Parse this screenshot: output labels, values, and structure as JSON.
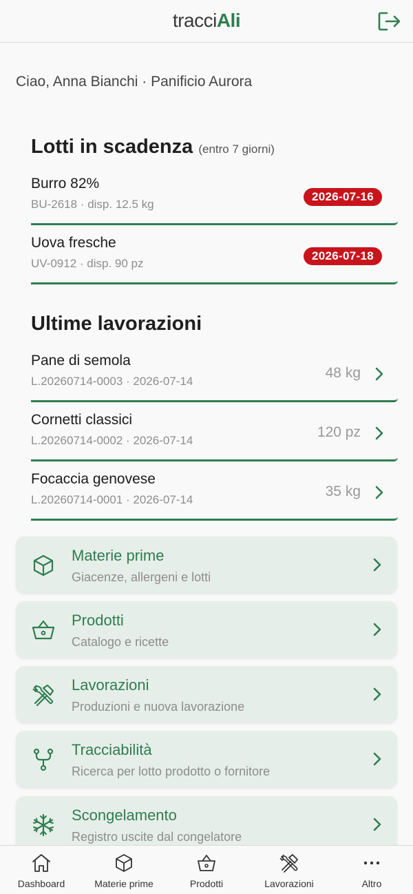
{
  "header": {
    "brand_part1": "tracci",
    "brand_part2": "Ali"
  },
  "greeting": "Ciao, Anna Bianchi · Panificio Aurora",
  "expiring": {
    "title": "Lotti in scadenza",
    "subtitle": "(entro 7 giorni)",
    "items": [
      {
        "name": "Burro 82%",
        "sub": "BU-2618 · disp. 12.5 kg",
        "date": "2026-07-16"
      },
      {
        "name": "Uova fresche",
        "sub": "UV-0912 · disp. 90 pz",
        "date": "2026-07-18"
      }
    ]
  },
  "recent": {
    "title": "Ultime lavorazioni",
    "items": [
      {
        "name": "Pane di semola",
        "sub": "L.20260714-0003 · 2026-07-14",
        "qty": "48 kg"
      },
      {
        "name": "Cornetti classici",
        "sub": "L.20260714-0002 · 2026-07-14",
        "qty": "120 pz"
      },
      {
        "name": "Focaccia genovese",
        "sub": "L.20260714-0001 · 2026-07-14",
        "qty": "35 kg"
      }
    ]
  },
  "menu": [
    {
      "title": "Materie prime",
      "desc": "Giacenze, allergeni e lotti",
      "icon": "box-icon"
    },
    {
      "title": "Prodotti",
      "desc": "Catalogo e ricette",
      "icon": "basket-icon"
    },
    {
      "title": "Lavorazioni",
      "desc": "Produzioni e nuova lavorazione",
      "icon": "tools-icon"
    },
    {
      "title": "Tracciabilità",
      "desc": "Ricerca per lotto prodotto o fornitore",
      "icon": "branch-icon"
    },
    {
      "title": "Scongelamento",
      "desc": "Registro uscite dal congelatore",
      "icon": "snowflake-icon"
    }
  ],
  "tabbar": [
    {
      "label": "Dashboard",
      "icon": "home-icon"
    },
    {
      "label": "Materie prime",
      "icon": "box-icon"
    },
    {
      "label": "Prodotti",
      "icon": "basket-icon"
    },
    {
      "label": "Lavorazioni",
      "icon": "tools-icon"
    },
    {
      "label": "Altro",
      "icon": "more-icon"
    }
  ],
  "colors": {
    "accent": "#2f7d4f",
    "badge": "#c8141c",
    "card_bg": "#e6eee9"
  }
}
